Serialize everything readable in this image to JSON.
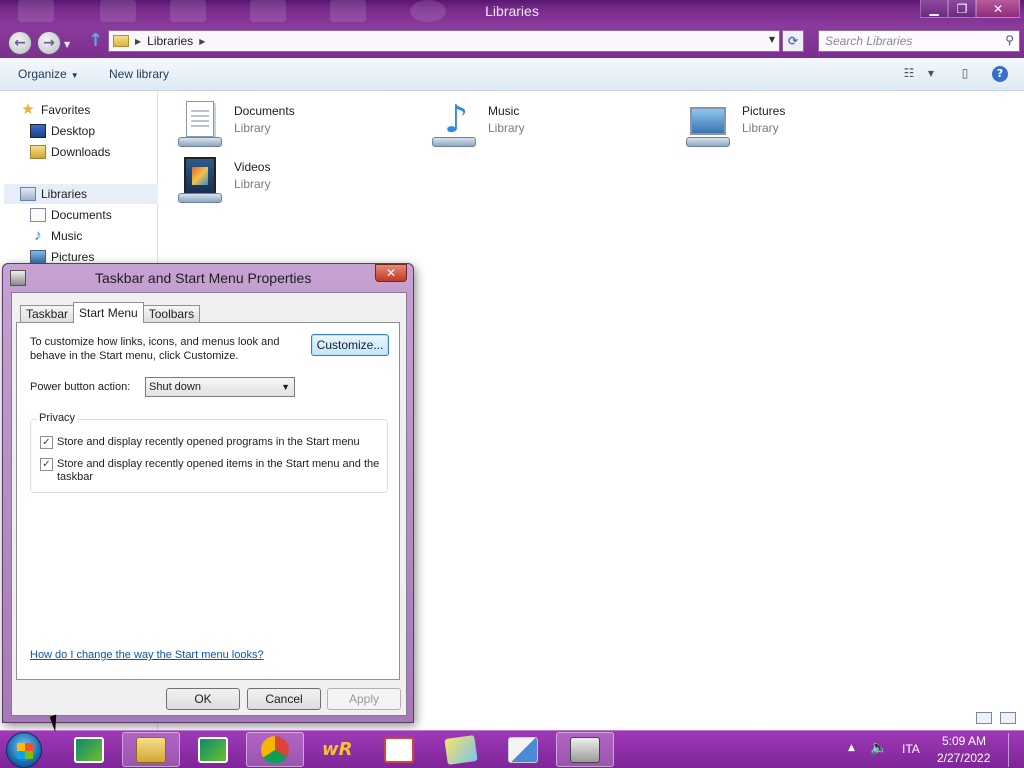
{
  "explorer": {
    "window_title": "Libraries",
    "address": {
      "crumb": "Libraries"
    },
    "search_placeholder": "Search Libraries",
    "toolbar": {
      "organize": "Organize",
      "new_library": "New library"
    },
    "nav": {
      "favorites": "Favorites",
      "desktop": "Desktop",
      "downloads": "Downloads",
      "libraries": "Libraries",
      "documents": "Documents",
      "music": "Music",
      "pictures": "Pictures"
    },
    "libraries": [
      {
        "name": "Documents",
        "type": "Library",
        "icon": "documents-library-icon"
      },
      {
        "name": "Music",
        "type": "Library",
        "icon": "music-library-icon"
      },
      {
        "name": "Pictures",
        "type": "Library",
        "icon": "pictures-library-icon"
      },
      {
        "name": "Videos",
        "type": "Library",
        "icon": "videos-library-icon"
      }
    ]
  },
  "dialog": {
    "title": "Taskbar and Start Menu Properties",
    "tabs": [
      "Taskbar",
      "Start Menu",
      "Toolbars"
    ],
    "active_tab": "Start Menu",
    "description": "To customize how links, icons, and menus look and behave in the Start menu, click Customize.",
    "customize_label": "Customize...",
    "power_label": "Power button action:",
    "power_value": "Shut down",
    "privacy": {
      "title": "Privacy",
      "items": [
        {
          "label": "Store and display recently opened programs in the Start menu",
          "checked": true
        },
        {
          "label": "Store and display recently opened items in the Start menu and the taskbar",
          "checked": true
        }
      ]
    },
    "help_link": "How do I change the way the Start menu looks?",
    "buttons": {
      "ok": "OK",
      "cancel": "Cancel",
      "apply": "Apply"
    }
  },
  "taskbar": {
    "items": [
      "start-orb",
      "credit-agricole-icon",
      "explorer-icon",
      "credit-agricole-icon",
      "chrome-icon",
      "wr-icon",
      "gmail-icon",
      "notes-icon",
      "translate-icon",
      "taskbar-properties-icon"
    ],
    "tray": {
      "language": "ITA",
      "time": "5:09 AM",
      "date": "2/27/2022"
    }
  },
  "colors": {
    "titlebar": "#7a2d8e",
    "taskbar": "#8e2ea8",
    "link": "#0b55b4"
  }
}
